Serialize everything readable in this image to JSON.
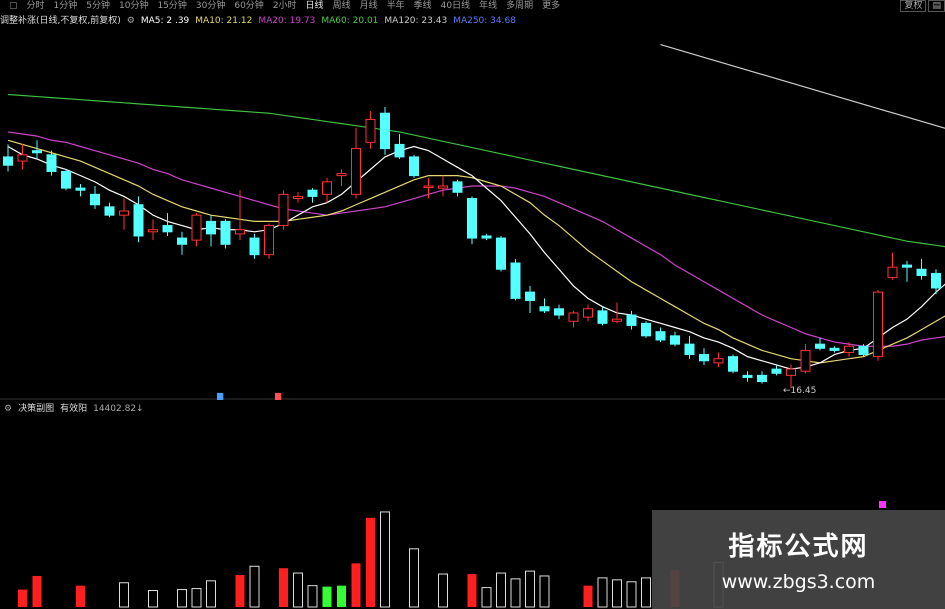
{
  "toolbar": {
    "periods": [
      "▢",
      "分时",
      "1分钟",
      "5分钟",
      "10分钟",
      "15分钟",
      "30分钟",
      "60分钟",
      "2小时",
      "日线",
      "周线",
      "月线",
      "半年",
      "季线",
      "40日线",
      "年线",
      "多周期",
      "更多"
    ],
    "active_period": "日线",
    "right_buttons": [
      "复权",
      "▤"
    ]
  },
  "info_bar": {
    "title": "调整补涨(日线,不复权,前复权)",
    "ma": [
      {
        "label": "MA5: 2 .39",
        "color": "#ffffff"
      },
      {
        "label": "MA10: 21.12",
        "color": "#e6d86e"
      },
      {
        "label": "MA20: 19.73",
        "color": "#cc44cc"
      },
      {
        "label": "MA60: 20.01",
        "color": "#4fc64f"
      },
      {
        "label": "MA120: 23.43",
        "color": "#cccccc"
      },
      {
        "label": "MA250: 34.68",
        "color": "#5b7dff"
      }
    ]
  },
  "indicator_bar": {
    "icon": "gear-icon",
    "name": "决策副图",
    "param": "有效阳",
    "value": "14402.82↓"
  },
  "markers": {
    "low_price": "←16.45",
    "flag_blue": "▆",
    "flag_red": "▆"
  },
  "watermark": {
    "title": "指标公式网",
    "url": "www.zbgs3.com"
  },
  "colors": {
    "bg": "#000000",
    "up": "#ff3232",
    "down": "#54ffff",
    "ma5": "#ffffff",
    "ma10": "#e6d86e",
    "ma20": "#cc44cc",
    "ma60": "#3fbf3f",
    "ma120": "#cccccc",
    "vol_red": "#ff1f1f",
    "vol_white": "#dddddd",
    "vol_green": "#33ff33",
    "vol_magenta": "#ff33ff"
  },
  "chart_data": [
    {
      "type": "candlestick",
      "candles": [
        {
          "o": 25.8,
          "h": 26.4,
          "l": 25.1,
          "c": 25.4
        },
        {
          "o": 25.6,
          "h": 26.4,
          "l": 25.2,
          "c": 25.9
        },
        {
          "o": 26.1,
          "h": 26.6,
          "l": 25.7,
          "c": 26.0
        },
        {
          "o": 25.9,
          "h": 26.1,
          "l": 24.9,
          "c": 25.1
        },
        {
          "o": 25.1,
          "h": 25.2,
          "l": 24.2,
          "c": 24.3
        },
        {
          "o": 24.3,
          "h": 24.5,
          "l": 23.9,
          "c": 24.2
        },
        {
          "o": 24.0,
          "h": 24.4,
          "l": 23.3,
          "c": 23.5
        },
        {
          "o": 23.4,
          "h": 23.6,
          "l": 22.9,
          "c": 23.0
        },
        {
          "o": 23.0,
          "h": 23.8,
          "l": 22.3,
          "c": 23.2
        },
        {
          "o": 23.5,
          "h": 23.9,
          "l": 21.7,
          "c": 22.0
        },
        {
          "o": 22.2,
          "h": 22.8,
          "l": 21.8,
          "c": 22.3
        },
        {
          "o": 22.5,
          "h": 23.1,
          "l": 22.0,
          "c": 22.2
        },
        {
          "o": 21.9,
          "h": 22.2,
          "l": 21.1,
          "c": 21.6
        },
        {
          "o": 21.8,
          "h": 23.1,
          "l": 21.5,
          "c": 23.0
        },
        {
          "o": 22.7,
          "h": 23.0,
          "l": 21.5,
          "c": 22.1
        },
        {
          "o": 22.7,
          "h": 22.8,
          "l": 21.4,
          "c": 21.6
        },
        {
          "o": 22.1,
          "h": 24.2,
          "l": 21.8,
          "c": 22.3
        },
        {
          "o": 21.9,
          "h": 22.1,
          "l": 20.9,
          "c": 21.1
        },
        {
          "o": 21.1,
          "h": 22.6,
          "l": 20.9,
          "c": 22.5
        },
        {
          "o": 22.5,
          "h": 24.2,
          "l": 22.3,
          "c": 24.0
        },
        {
          "o": 23.8,
          "h": 24.1,
          "l": 23.6,
          "c": 23.9
        },
        {
          "o": 24.2,
          "h": 24.3,
          "l": 23.6,
          "c": 23.9
        },
        {
          "o": 24.0,
          "h": 24.8,
          "l": 23.6,
          "c": 24.6
        },
        {
          "o": 24.9,
          "h": 25.2,
          "l": 24.4,
          "c": 25.0
        },
        {
          "o": 24.0,
          "h": 27.2,
          "l": 23.8,
          "c": 26.2
        },
        {
          "o": 26.5,
          "h": 28.0,
          "l": 26.2,
          "c": 27.6
        },
        {
          "o": 27.9,
          "h": 28.2,
          "l": 25.9,
          "c": 26.2
        },
        {
          "o": 26.4,
          "h": 26.9,
          "l": 25.7,
          "c": 25.8
        },
        {
          "o": 25.8,
          "h": 25.9,
          "l": 24.8,
          "c": 24.9
        },
        {
          "o": 24.4,
          "h": 24.8,
          "l": 23.8,
          "c": 24.4
        },
        {
          "o": 24.3,
          "h": 24.9,
          "l": 23.9,
          "c": 24.4
        },
        {
          "o": 24.6,
          "h": 24.7,
          "l": 23.9,
          "c": 24.1
        },
        {
          "o": 23.8,
          "h": 23.9,
          "l": 21.6,
          "c": 21.9
        },
        {
          "o": 22.0,
          "h": 22.1,
          "l": 21.8,
          "c": 21.9
        },
        {
          "o": 21.9,
          "h": 22.0,
          "l": 20.3,
          "c": 20.4
        },
        {
          "o": 20.7,
          "h": 20.9,
          "l": 18.9,
          "c": 19.0
        },
        {
          "o": 19.3,
          "h": 19.6,
          "l": 18.3,
          "c": 18.9
        },
        {
          "o": 18.6,
          "h": 19.0,
          "l": 18.3,
          "c": 18.4
        },
        {
          "o": 18.5,
          "h": 18.7,
          "l": 18.0,
          "c": 18.2
        },
        {
          "o": 17.9,
          "h": 18.4,
          "l": 17.6,
          "c": 18.3
        },
        {
          "o": 18.1,
          "h": 18.7,
          "l": 17.9,
          "c": 18.5
        },
        {
          "o": 18.4,
          "h": 18.6,
          "l": 17.7,
          "c": 17.8
        },
        {
          "o": 17.9,
          "h": 18.8,
          "l": 17.8,
          "c": 18.0
        },
        {
          "o": 18.2,
          "h": 18.4,
          "l": 17.5,
          "c": 17.7
        },
        {
          "o": 17.8,
          "h": 17.9,
          "l": 17.1,
          "c": 17.2
        },
        {
          "o": 17.4,
          "h": 17.6,
          "l": 16.9,
          "c": 17.0
        },
        {
          "o": 17.2,
          "h": 17.4,
          "l": 16.7,
          "c": 16.8
        },
        {
          "o": 16.8,
          "h": 17.2,
          "l": 16.1,
          "c": 16.3
        },
        {
          "o": 16.3,
          "h": 16.6,
          "l": 15.8,
          "c": 16.0
        },
        {
          "o": 15.9,
          "h": 16.4,
          "l": 15.7,
          "c": 16.1
        },
        {
          "o": 16.2,
          "h": 16.3,
          "l": 15.4,
          "c": 15.5
        },
        {
          "o": 15.3,
          "h": 15.5,
          "l": 15.0,
          "c": 15.2
        },
        {
          "o": 15.3,
          "h": 15.5,
          "l": 14.9,
          "c": 15.0
        },
        {
          "o": 15.6,
          "h": 15.8,
          "l": 15.3,
          "c": 15.4
        },
        {
          "o": 15.3,
          "h": 15.8,
          "l": 14.7,
          "c": 15.6
        },
        {
          "o": 15.5,
          "h": 16.8,
          "l": 15.4,
          "c": 16.5
        },
        {
          "o": 16.8,
          "h": 17.1,
          "l": 16.5,
          "c": 16.6
        },
        {
          "o": 16.6,
          "h": 16.7,
          "l": 16.4,
          "c": 16.5
        },
        {
          "o": 16.4,
          "h": 16.9,
          "l": 16.2,
          "c": 16.7
        },
        {
          "o": 16.7,
          "h": 16.8,
          "l": 16.2,
          "c": 16.3
        },
        {
          "o": 16.2,
          "h": 19.4,
          "l": 16.0,
          "c": 19.3
        },
        {
          "o": 20.0,
          "h": 21.2,
          "l": 19.9,
          "c": 20.5
        },
        {
          "o": 20.6,
          "h": 20.8,
          "l": 19.8,
          "c": 20.5
        },
        {
          "o": 20.4,
          "h": 20.9,
          "l": 19.9,
          "c": 20.1
        },
        {
          "o": 20.2,
          "h": 20.4,
          "l": 19.2,
          "c": 19.5
        },
        {
          "o": 19.3,
          "h": 19.4,
          "l": 18.7,
          "c": 18.8
        }
      ],
      "ma5": [
        26.3,
        25.9,
        25.7,
        25.4,
        25.2,
        24.9,
        24.6,
        24.2,
        23.9,
        23.5,
        23.0,
        22.7,
        22.5,
        22.3,
        22.4,
        22.3,
        22.3,
        22.2,
        22.3,
        22.6,
        23.0,
        23.4,
        23.6,
        24.0,
        24.6,
        25.2,
        25.8,
        26.1,
        26.3,
        26.1,
        25.7,
        25.3,
        24.9,
        24.3,
        23.7,
        22.9,
        22.1,
        21.2,
        20.4,
        19.6,
        19.0,
        18.6,
        18.3,
        18.2,
        18.0,
        17.8,
        17.6,
        17.4,
        17.1,
        16.9,
        16.6,
        16.2,
        16.0,
        15.8,
        15.6,
        15.7,
        15.9,
        16.3,
        16.5,
        16.6,
        17.1,
        17.6,
        18.0,
        18.6,
        19.3,
        19.9
      ],
      "ma10": [
        26.6,
        26.4,
        26.2,
        26.0,
        25.8,
        25.6,
        25.3,
        25.0,
        24.7,
        24.4,
        24.0,
        23.7,
        23.4,
        23.2,
        23.0,
        22.9,
        22.8,
        22.7,
        22.7,
        22.7,
        22.8,
        22.9,
        23.0,
        23.2,
        23.5,
        23.8,
        24.1,
        24.4,
        24.7,
        24.9,
        24.9,
        24.9,
        24.8,
        24.6,
        24.4,
        24.0,
        23.6,
        23.0,
        22.5,
        21.9,
        21.3,
        20.8,
        20.3,
        19.8,
        19.4,
        19.0,
        18.6,
        18.2,
        17.8,
        17.5,
        17.1,
        16.8,
        16.5,
        16.3,
        16.1,
        16.0,
        15.9,
        16.0,
        16.1,
        16.2,
        16.5,
        16.8,
        17.1,
        17.5,
        17.9,
        18.3
      ],
      "ma20": [
        27.0,
        26.9,
        26.8,
        26.6,
        26.5,
        26.3,
        26.1,
        25.9,
        25.7,
        25.5,
        25.2,
        25.0,
        24.7,
        24.5,
        24.3,
        24.1,
        23.9,
        23.7,
        23.5,
        23.3,
        23.2,
        23.1,
        23.0,
        23.1,
        23.2,
        23.3,
        23.4,
        23.6,
        23.8,
        24.0,
        24.2,
        24.3,
        24.4,
        24.4,
        24.4,
        24.3,
        24.1,
        23.9,
        23.6,
        23.3,
        23.0,
        22.7,
        22.3,
        21.9,
        21.5,
        21.1,
        20.6,
        20.2,
        19.8,
        19.4,
        19.0,
        18.6,
        18.2,
        17.9,
        17.6,
        17.3,
        17.1,
        16.9,
        16.8,
        16.7,
        16.7,
        16.7,
        16.8,
        17.0,
        17.1,
        17.2
      ],
      "ma60": [
        28.8,
        28.75,
        28.7,
        28.65,
        28.6,
        28.55,
        28.5,
        28.45,
        28.4,
        28.35,
        28.3,
        28.25,
        28.2,
        28.15,
        28.1,
        28.05,
        28.0,
        27.95,
        27.9,
        27.8,
        27.7,
        27.6,
        27.5,
        27.4,
        27.3,
        27.2,
        27.1,
        27.0,
        26.85,
        26.7,
        26.55,
        26.4,
        26.25,
        26.1,
        25.95,
        25.8,
        25.65,
        25.5,
        25.35,
        25.2,
        25.05,
        24.9,
        24.75,
        24.6,
        24.45,
        24.3,
        24.15,
        24.0,
        23.85,
        23.7,
        23.55,
        23.4,
        23.25,
        23.1,
        22.95,
        22.8,
        22.65,
        22.5,
        22.35,
        22.2,
        22.05,
        21.9,
        21.75,
        21.65,
        21.55,
        21.45
      ],
      "ma120": {
        "from": 45,
        "to": 65,
        "start": 31.2,
        "end": 27.1
      },
      "ylim": [
        14.5,
        31.9
      ]
    },
    {
      "type": "bar",
      "values": [
        0,
        18,
        32,
        0,
        0,
        22,
        0,
        0,
        25,
        0,
        17,
        0,
        18,
        19,
        27,
        0,
        33,
        42,
        0,
        40,
        35,
        22,
        21,
        22,
        45,
        92,
        98,
        0,
        60,
        0,
        34,
        0,
        34,
        20,
        35,
        29,
        37,
        32,
        0,
        0,
        22,
        30,
        28,
        26,
        30,
        0,
        38,
        0,
        0,
        46,
        0,
        0,
        0,
        0,
        0,
        0,
        0,
        0,
        0,
        0,
        0,
        0,
        0,
        0,
        0,
        0
      ],
      "colors": [
        "w",
        "r",
        "r",
        "w",
        "w",
        "r",
        "w",
        "w",
        "w",
        "w",
        "w",
        "w",
        "w",
        "w",
        "w",
        "w",
        "r",
        "w",
        "w",
        "r",
        "w",
        "w",
        "g",
        "g",
        "r",
        "r",
        "w",
        "w",
        "w",
        "w",
        "w",
        "w",
        "r",
        "w",
        "w",
        "w",
        "w",
        "w",
        "w",
        "w",
        "r",
        "w",
        "w",
        "w",
        "w",
        "w",
        "r",
        "w",
        "w",
        "w",
        "w",
        "w",
        "w",
        "w",
        "w",
        "w",
        "w",
        "w",
        "w",
        "w",
        "w",
        "w",
        "w",
        "w",
        "w",
        "w"
      ],
      "ylim": [
        0,
        100
      ],
      "extra_mark": "magenta"
    }
  ]
}
